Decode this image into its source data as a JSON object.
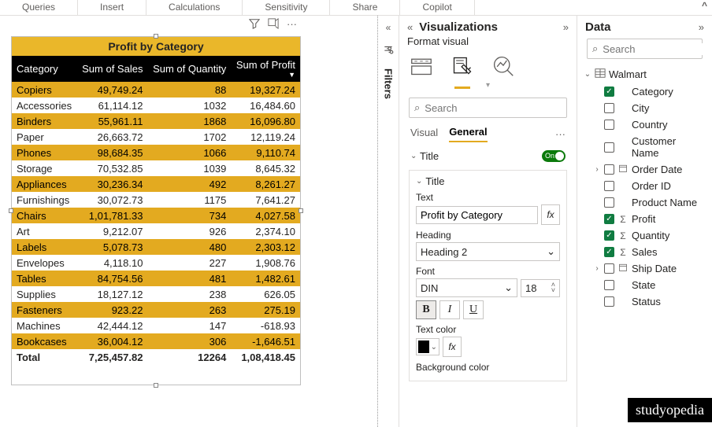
{
  "ribbon": [
    "Queries",
    "Insert",
    "Calculations",
    "Sensitivity",
    "Share",
    "Copilot"
  ],
  "visual": {
    "title": "Profit by Category",
    "columns": [
      "Category",
      "Sum of Sales",
      "Sum of Quantity",
      "Sum of Profit"
    ],
    "rows": [
      {
        "c": "Copiers",
        "s": "49,749.24",
        "q": "88",
        "p": "19,327.24",
        "g": true
      },
      {
        "c": "Accessories",
        "s": "61,114.12",
        "q": "1032",
        "p": "16,484.60",
        "g": false
      },
      {
        "c": "Binders",
        "s": "55,961.11",
        "q": "1868",
        "p": "16,096.80",
        "g": true
      },
      {
        "c": "Paper",
        "s": "26,663.72",
        "q": "1702",
        "p": "12,119.24",
        "g": false
      },
      {
        "c": "Phones",
        "s": "98,684.35",
        "q": "1066",
        "p": "9,110.74",
        "g": true
      },
      {
        "c": "Storage",
        "s": "70,532.85",
        "q": "1039",
        "p": "8,645.32",
        "g": false
      },
      {
        "c": "Appliances",
        "s": "30,236.34",
        "q": "492",
        "p": "8,261.27",
        "g": true
      },
      {
        "c": "Furnishings",
        "s": "30,072.73",
        "q": "1175",
        "p": "7,641.27",
        "g": false
      },
      {
        "c": "Chairs",
        "s": "1,01,781.33",
        "q": "734",
        "p": "4,027.58",
        "g": true
      },
      {
        "c": "Art",
        "s": "9,212.07",
        "q": "926",
        "p": "2,374.10",
        "g": false
      },
      {
        "c": "Labels",
        "s": "5,078.73",
        "q": "480",
        "p": "2,303.12",
        "g": true
      },
      {
        "c": "Envelopes",
        "s": "4,118.10",
        "q": "227",
        "p": "1,908.76",
        "g": false
      },
      {
        "c": "Tables",
        "s": "84,754.56",
        "q": "481",
        "p": "1,482.61",
        "g": true
      },
      {
        "c": "Supplies",
        "s": "18,127.12",
        "q": "238",
        "p": "626.05",
        "g": false
      },
      {
        "c": "Fasteners",
        "s": "923.22",
        "q": "263",
        "p": "275.19",
        "g": true
      },
      {
        "c": "Machines",
        "s": "42,444.12",
        "q": "147",
        "p": "-618.93",
        "g": false
      },
      {
        "c": "Bookcases",
        "s": "36,004.12",
        "q": "306",
        "p": "-1,646.51",
        "g": true
      }
    ],
    "total": {
      "c": "Total",
      "s": "7,25,457.82",
      "q": "12264",
      "p": "1,08,418.45"
    }
  },
  "filters_label": "Filters",
  "viz": {
    "header": "Visualizations",
    "sub": "Format visual",
    "search_ph": "Search",
    "tabs": {
      "visual": "Visual",
      "general": "General"
    },
    "title_section": "Title",
    "card": {
      "title": "Title",
      "text_lbl": "Text",
      "text_val": "Profit by Category",
      "heading_lbl": "Heading",
      "heading_val": "Heading 2",
      "font_lbl": "Font",
      "font_val": "DIN",
      "font_size": "18",
      "textcolor_lbl": "Text color",
      "bgcolor_lbl": "Background color"
    },
    "toggle_on": "On"
  },
  "data": {
    "header": "Data",
    "search_ph": "Search",
    "table": "Walmart",
    "fields": [
      {
        "n": "Category",
        "ck": true,
        "exp": "",
        "ico": ""
      },
      {
        "n": "City",
        "ck": false,
        "exp": "",
        "ico": ""
      },
      {
        "n": "Country",
        "ck": false,
        "exp": "",
        "ico": ""
      },
      {
        "n": "Customer Name",
        "ck": false,
        "exp": "",
        "ico": ""
      },
      {
        "n": "Order Date",
        "ck": false,
        "exp": "›",
        "ico": "cal"
      },
      {
        "n": "Order ID",
        "ck": false,
        "exp": "",
        "ico": ""
      },
      {
        "n": "Product Name",
        "ck": false,
        "exp": "",
        "ico": ""
      },
      {
        "n": "Profit",
        "ck": true,
        "exp": "",
        "ico": "sum"
      },
      {
        "n": "Quantity",
        "ck": true,
        "exp": "",
        "ico": "sum"
      },
      {
        "n": "Sales",
        "ck": true,
        "exp": "",
        "ico": "sum"
      },
      {
        "n": "Ship Date",
        "ck": false,
        "exp": "›",
        "ico": "cal"
      },
      {
        "n": "State",
        "ck": false,
        "exp": "",
        "ico": ""
      },
      {
        "n": "Status",
        "ck": false,
        "exp": "",
        "ico": ""
      }
    ]
  },
  "watermark": "studyopedia"
}
